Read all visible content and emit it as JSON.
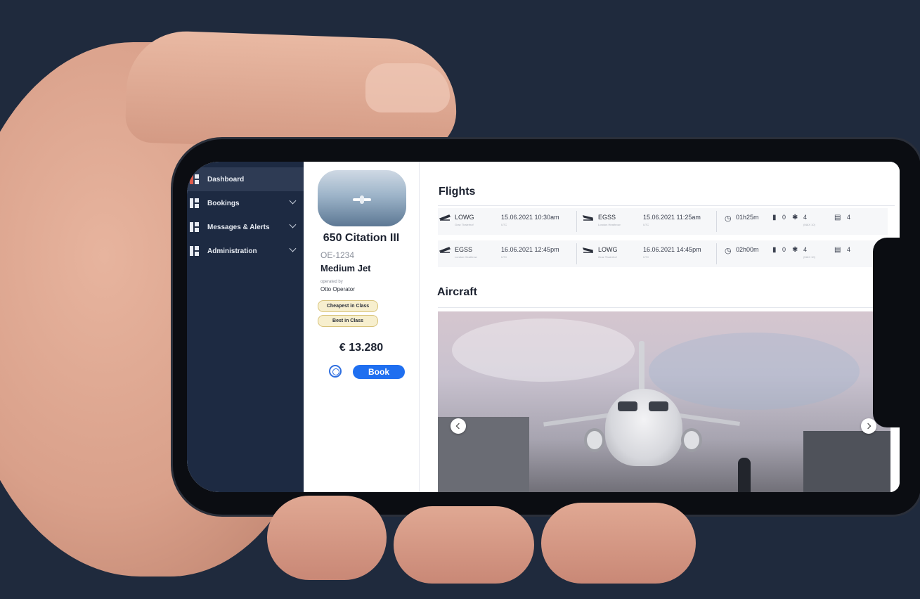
{
  "sidebar": {
    "items": [
      {
        "label": "Dashboard",
        "active": true,
        "expandable": false
      },
      {
        "label": "Bookings",
        "active": false,
        "expandable": true
      },
      {
        "label": "Messages & Alerts",
        "active": false,
        "expandable": true
      },
      {
        "label": "Administration",
        "active": false,
        "expandable": true
      }
    ]
  },
  "card": {
    "title": "650 Citation III",
    "registration": "OE-1234",
    "class": "Medium Jet",
    "operated_by_label": "operated by",
    "operator": "Otto Operator",
    "tags": [
      "Cheapest in Class",
      "Best in Class"
    ],
    "price": "€ 13.280",
    "book_label": "Book"
  },
  "flights": {
    "heading": "Flights",
    "rows": [
      {
        "dep_code": "LOWG",
        "dep_name": "Graz Thalerhof",
        "dep_time": "15.06.2021 10:30am",
        "dep_tz": "UTC",
        "arr_code": "EGSS",
        "arr_name": "London Heathrow",
        "arr_time": "15.06.2021 11:25am",
        "arr_tz": "UTC",
        "duration": "01h25m",
        "fuel": "0",
        "pax": "4",
        "pax_sub": "(MAX 10)",
        "beds": "4"
      },
      {
        "dep_code": "EGSS",
        "dep_name": "London Heathrow",
        "dep_time": "16.06.2021 12:45pm",
        "dep_tz": "UTC",
        "arr_code": "LOWG",
        "arr_name": "Graz Thalerhof",
        "arr_time": "16.06.2021 14:45pm",
        "arr_tz": "UTC",
        "duration": "02h00m",
        "fuel": "0",
        "pax": "4",
        "pax_sub": "(MAX 10)",
        "beds": "4"
      }
    ]
  },
  "aircraft": {
    "heading": "Aircraft"
  },
  "colors": {
    "background": "#1f2a3d",
    "sidebar": "#1d2a42",
    "accent": "#1f6ff0",
    "tag_fill": "#f7efce"
  }
}
